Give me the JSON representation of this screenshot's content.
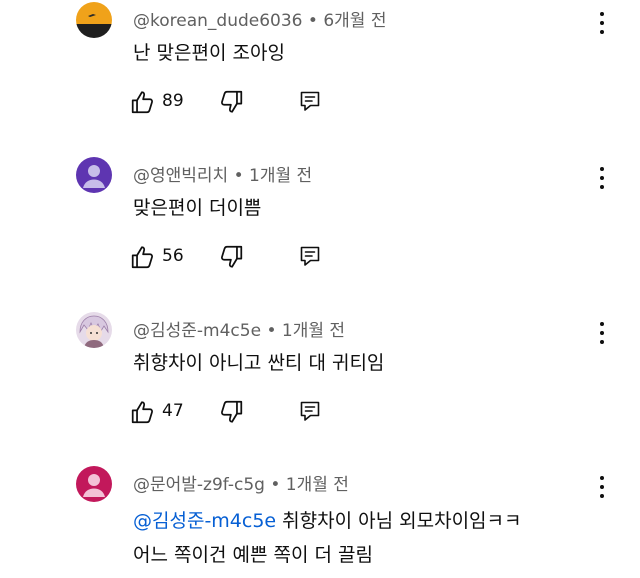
{
  "comments": [
    {
      "author": "@korean_dude6036",
      "age": "6개월 전",
      "text": "난 맞은편이 조아잉",
      "likes": "89",
      "avatar_colors": [
        "#f0a21a",
        "#1f1f1f"
      ],
      "avatar_icon": "sunset-avatar"
    },
    {
      "author": "@영앤빅리치",
      "age": "1개월 전",
      "text": "맞은편이 더이쁨",
      "likes": "56",
      "avatar_colors": [
        "#5e35b1",
        "#c7bde9"
      ],
      "avatar_icon": "default-person-avatar"
    },
    {
      "author": "@김성준-m4c5e",
      "age": "1개월 전",
      "text": "취향차이 아니고 싼티 대 귀티임",
      "likes": "47",
      "avatar_colors": [
        "#d8c8e0",
        "#8f6a7e"
      ],
      "avatar_icon": "anime-character-avatar"
    },
    {
      "author": "@문어발-z9f-c5g",
      "age": "1개월 전",
      "mention": "@김성준-m4c5e",
      "text_line1": " 취향차이 아님 외모차이임ㅋㅋ",
      "text_line2": "어느 쪽이건 예쁜 쪽이 더 끌림",
      "avatar_colors": [
        "#c2185b",
        "#f3c1d6"
      ],
      "avatar_icon": "default-person-avatar"
    }
  ],
  "separator": " • ",
  "icons": {
    "like": "thumbs-up-icon",
    "dislike": "thumbs-down-icon",
    "reply": "reply-comment-icon",
    "more": "more-vertical-icon"
  }
}
